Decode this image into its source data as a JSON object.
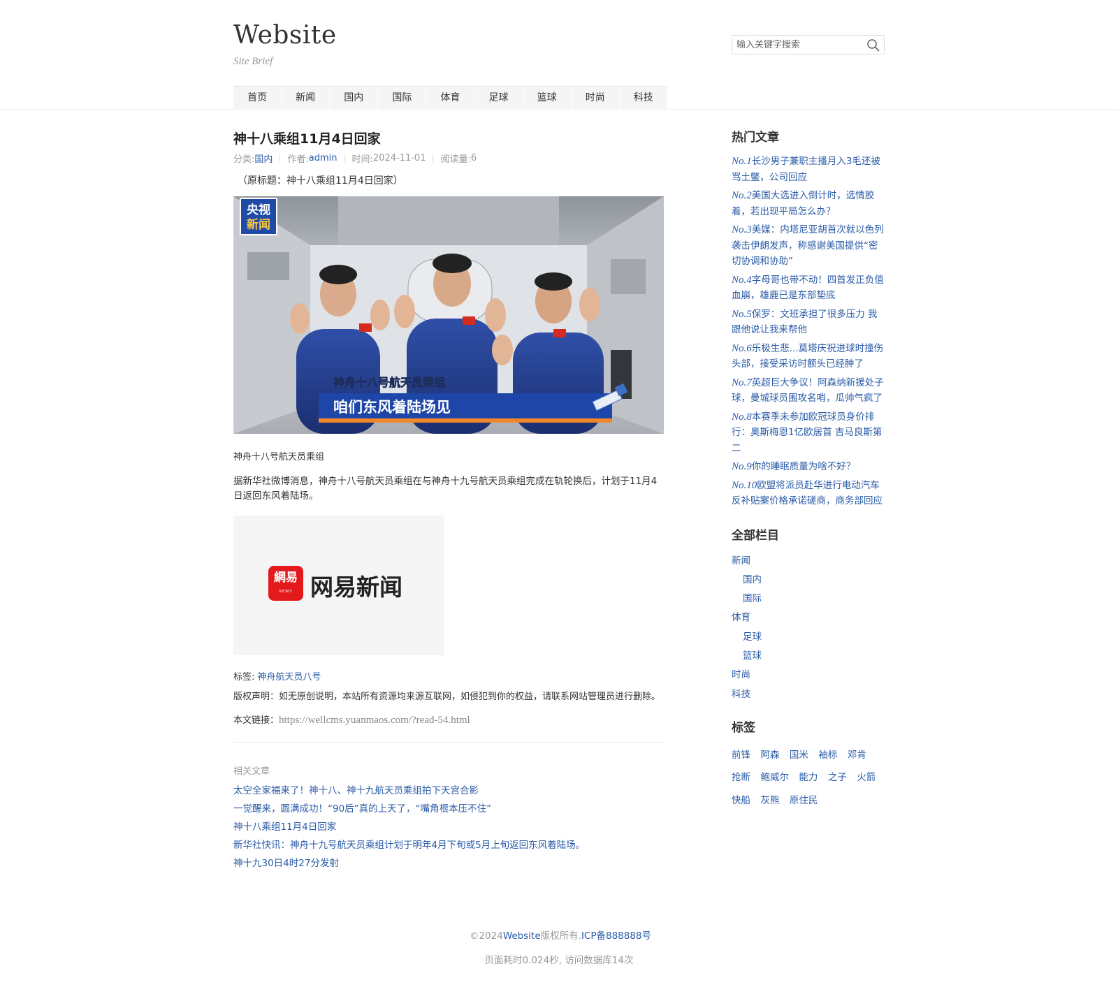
{
  "site": {
    "logo": "Website",
    "brief": "Site Brief"
  },
  "search": {
    "placeholder": "输入关键字搜索",
    "icon": "search-icon"
  },
  "nav": [
    "首页",
    "新闻",
    "国内",
    "国际",
    "体育",
    "足球",
    "篮球",
    "时尚",
    "科技"
  ],
  "article": {
    "title": "神十八乘组11月4日回家",
    "meta": {
      "category_label": "分类:",
      "category": "国内",
      "author_label": "作者:",
      "author": "admin",
      "time_label": "时间:",
      "time": "2024-11-01",
      "views_label": "阅读量:",
      "views": "6"
    },
    "original_title": "（原标题：神十八乘组11月4日回家）",
    "photo": {
      "logo_line1": "央视",
      "logo_line2": "新闻",
      "banner_top": "神舟十八号航天员乘组",
      "banner_main": "咱们东风着陆场见"
    },
    "caption": "神舟十八号航天员乘组",
    "body": "据新华社微博消息，神舟十八号航天员乘组在与神舟十九号航天员乘组完成在轨轮换后，计划于11月4日返回东风着陆场。",
    "netease": {
      "icon_text": "網易",
      "icon_sub": "NEWS",
      "name": "网易新闻"
    },
    "tags_label": "标签:",
    "tag": "神舟航天员八号",
    "copyright": "版权声明：如无原创说明，本站所有资源均来源互联网，如侵犯到你的权益，请联系网站管理员进行删除。",
    "link_label": "本文链接：",
    "link_url": "https://wellcms.yuanmaos.com/?read-54.html"
  },
  "related": {
    "title": "相关文章",
    "items": [
      "太空全家福来了！神十八、神十九航天员乘组拍下天宫合影",
      "一觉醒来，圆满成功！“90后”真的上天了，“嘴角根本压不住”",
      "神十八乘组11月4日回家",
      "新华社快讯：神舟十九号航天员乘组计划于明年4月下旬或5月上旬返回东风着陆场。",
      "神十九30日4时27分发射"
    ]
  },
  "sidebar": {
    "hot_title": "热门文章",
    "hot": [
      {
        "no": "No.1",
        "text": "长沙男子兼职主播月入3毛还被骂土鳖，公司回应"
      },
      {
        "no": "No.2",
        "text": "美国大选进入倒计时，选情胶着，若出现平局怎么办？"
      },
      {
        "no": "No.3",
        "text": "美媒：内塔尼亚胡首次就以色列袭击伊朗发声，称感谢美国提供“密切协调和协助”"
      },
      {
        "no": "No.4",
        "text": "字母哥也带不动！四首发正负值血崩，雄鹿已是东部垫底"
      },
      {
        "no": "No.5",
        "text": "保罗：文班承担了很多压力 我跟他说让我来帮他"
      },
      {
        "no": "No.6",
        "text": "乐极生悲...莫塔庆祝进球时撞伤头部，接受采访时额头已经肿了"
      },
      {
        "no": "No.7",
        "text": "英超巨大争议！阿森纳新援处子球，曼城球员围攻名哨，瓜帅气疯了"
      },
      {
        "no": "No.8",
        "text": "本赛季未参加欧冠球员身价排行：奥斯梅恩1亿欧居首 吉马良斯第二"
      },
      {
        "no": "No.9",
        "text": "你的睡眠质量为啥不好？"
      },
      {
        "no": "No.10",
        "text": "欧盟将派员赴华进行电动汽车反补贴案价格承诺磋商，商务部回应"
      }
    ],
    "cats_title": "全部栏目",
    "cats": [
      {
        "name": "新闻",
        "sub": false
      },
      {
        "name": "国内",
        "sub": true
      },
      {
        "name": "国际",
        "sub": true
      },
      {
        "name": "体育",
        "sub": false
      },
      {
        "name": "足球",
        "sub": true
      },
      {
        "name": "篮球",
        "sub": true
      },
      {
        "name": "时尚",
        "sub": false
      },
      {
        "name": "科技",
        "sub": false
      }
    ],
    "tags_title": "标签",
    "tags": [
      "前锋",
      "阿森",
      "国米",
      "袖标",
      "邓肯",
      "抢断",
      "鲍威尔",
      "能力",
      "之子",
      "火箭",
      "快船",
      "灰熊",
      "原住民"
    ]
  },
  "footer": {
    "copyright_pre": "©2024",
    "site": "Website",
    "copyright_mid": "版权所有.",
    "icp": "ICP备888888号",
    "stats": "页面耗时0.024秒, 访问数据库14次"
  },
  "colors": {
    "link": "#2a5ba8",
    "muted": "#999999",
    "nav_bg": "#f5f5f5"
  }
}
